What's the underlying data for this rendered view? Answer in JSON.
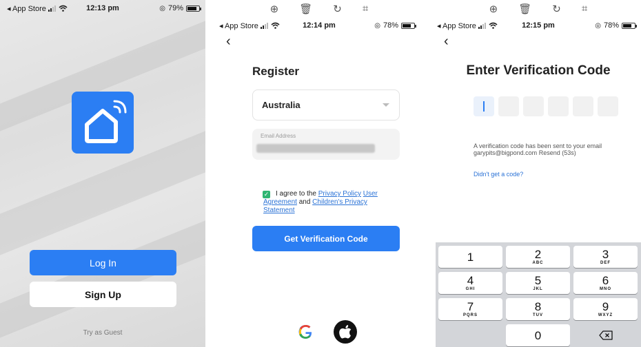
{
  "screen1": {
    "status": {
      "carrier": "◂ App Store",
      "time": "12:13 pm",
      "battery": "79%",
      "battery_level": 0.79
    },
    "app_icon": "smart-home-icon",
    "login_label": "Log In",
    "signup_label": "Sign Up",
    "guest_label": "Try as Guest"
  },
  "screen2": {
    "status": {
      "carrier": "◂ App Store",
      "time": "12:14 pm",
      "battery": "78%",
      "battery_level": 0.78
    },
    "edit_icons": [
      "zoom-in-icon",
      "trash-icon",
      "rotate-icon",
      "crop-icon"
    ],
    "title": "Register",
    "country": "Australia",
    "email_label": "Email Address",
    "agree": {
      "prefix": "I agree to the ",
      "privacy": "Privacy Policy",
      "user_agreement": "User Agreement",
      "and": " and ",
      "children": "Children's Privacy Statement"
    },
    "verify_button": "Get Verification Code",
    "social": [
      "google-icon",
      "apple-icon"
    ],
    "google_glyph": "G"
  },
  "screen3": {
    "status": {
      "carrier": "◂ App Store",
      "time": "12:15 pm",
      "battery": "78%",
      "battery_level": 0.78
    },
    "edit_icons": [
      "zoom-in-icon",
      "trash-icon",
      "rotate-icon",
      "crop-icon"
    ],
    "title": "Enter Verification Code",
    "sent_message": "A verification code has been sent to your email garypits@bigpond.com",
    "resend": "Resend (53s)",
    "didnt_get": "Didn't get a code?",
    "keys": [
      {
        "num": "1",
        "letters": ""
      },
      {
        "num": "2",
        "letters": "ABC"
      },
      {
        "num": "3",
        "letters": "DEF"
      },
      {
        "num": "4",
        "letters": "GHI"
      },
      {
        "num": "5",
        "letters": "JKL"
      },
      {
        "num": "6",
        "letters": "MNO"
      },
      {
        "num": "7",
        "letters": "PQRS"
      },
      {
        "num": "8",
        "letters": "TUV"
      },
      {
        "num": "9",
        "letters": "WXYZ"
      },
      {
        "num": "0",
        "letters": ""
      }
    ]
  }
}
